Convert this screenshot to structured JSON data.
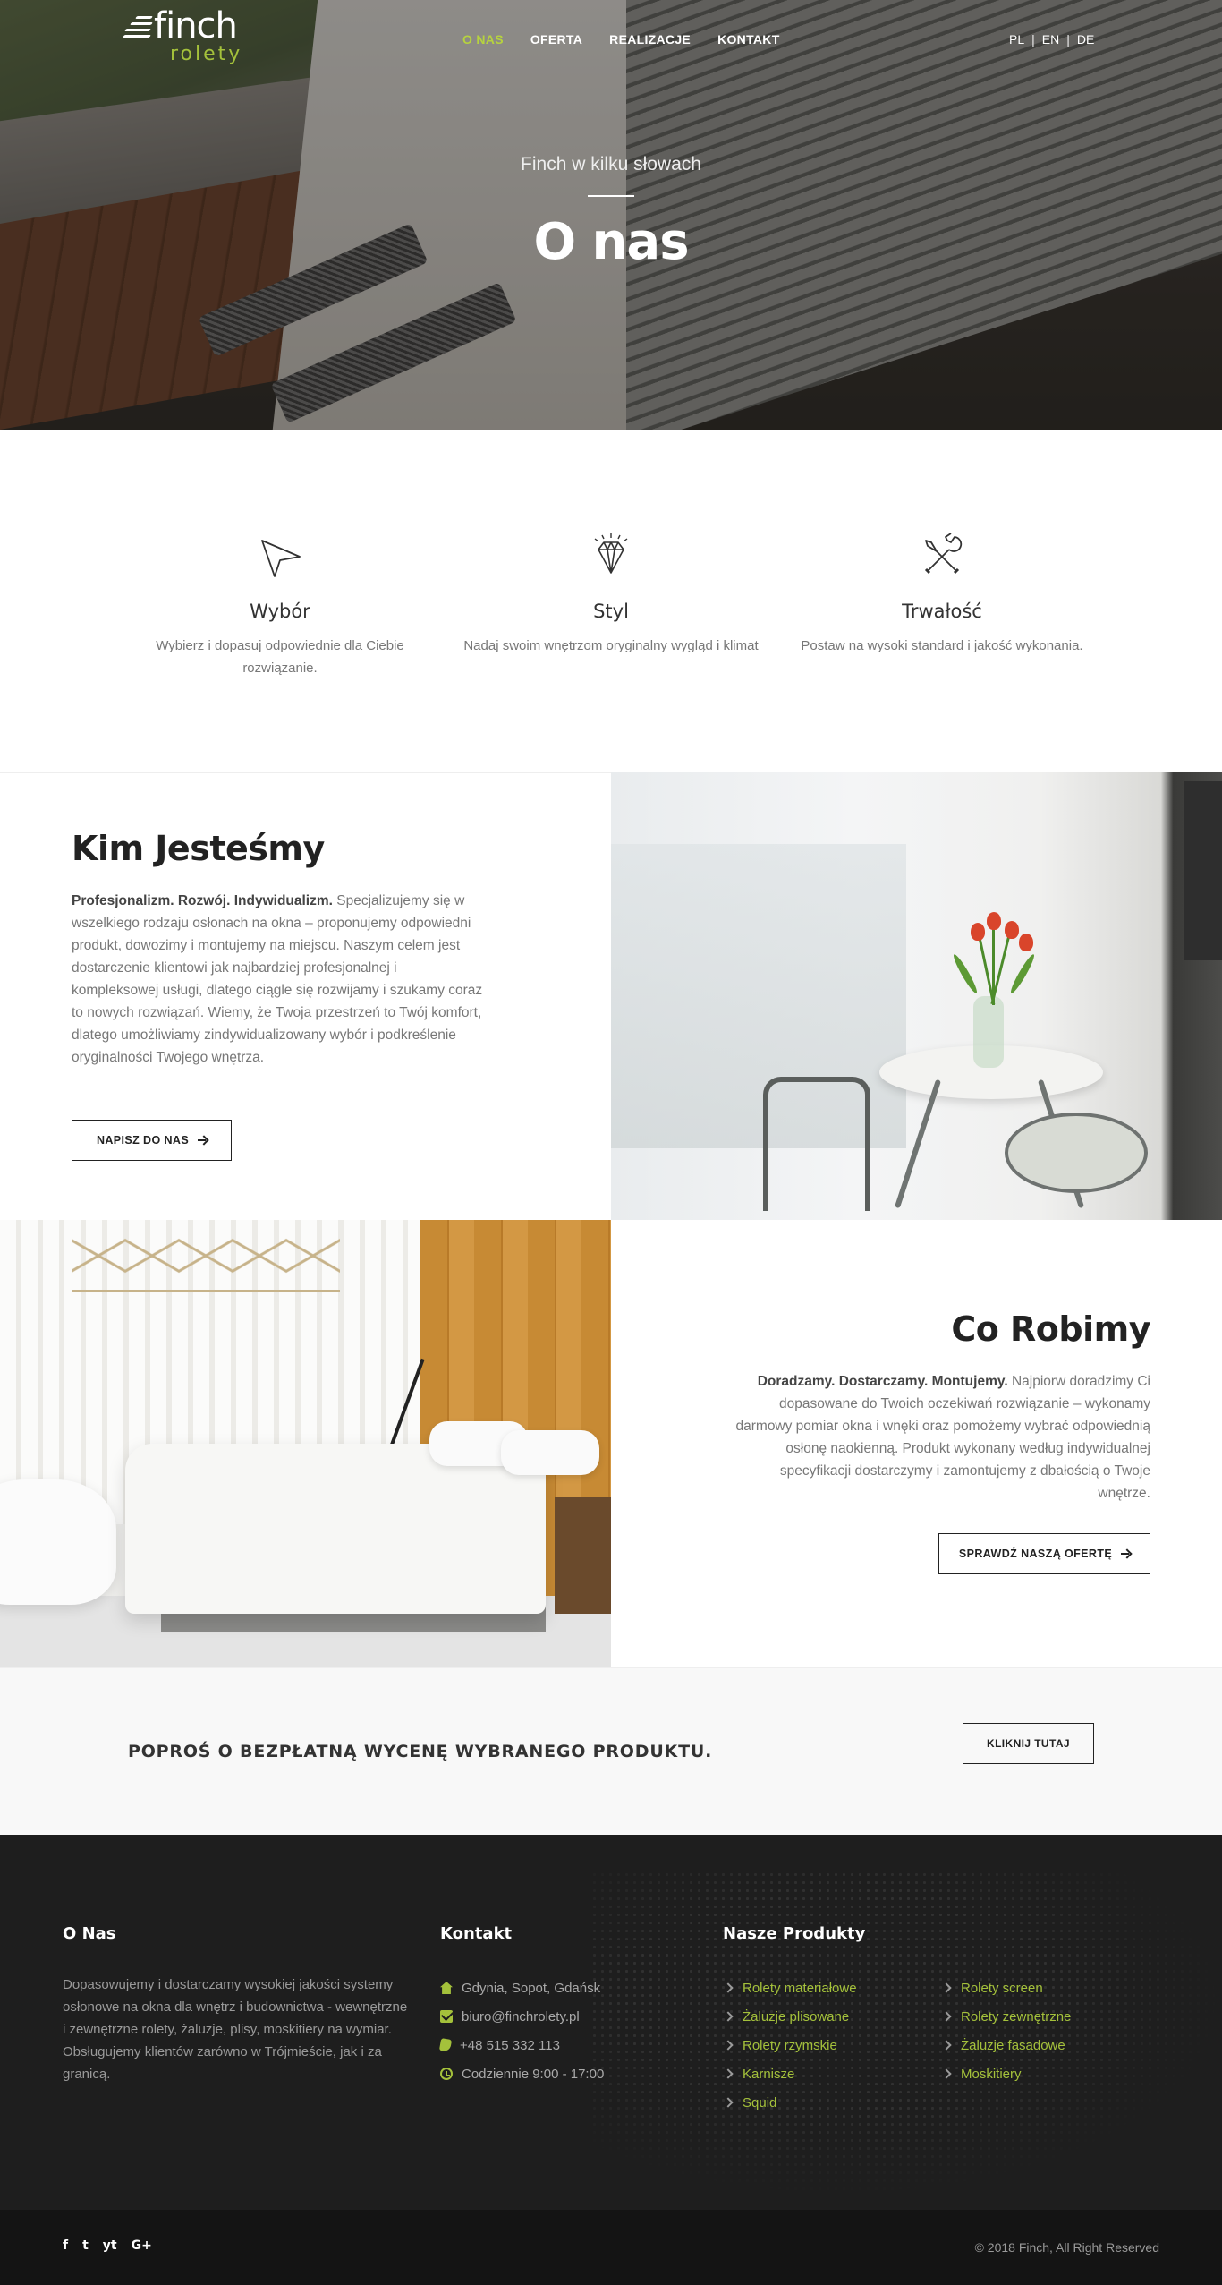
{
  "brand": {
    "name": "finch",
    "sub": "rolety",
    "accent": "#a4c13b"
  },
  "nav": {
    "items": [
      {
        "label": "O NAS",
        "active": true
      },
      {
        "label": "OFERTA",
        "active": false
      },
      {
        "label": "REALIZACJE",
        "active": false
      },
      {
        "label": "KONTAKT",
        "active": false
      }
    ],
    "langs": [
      "PL",
      "EN",
      "DE"
    ],
    "lang_sep": "|"
  },
  "hero": {
    "eyebrow": "Finch w kilku słowach",
    "title": "O nas"
  },
  "features": [
    {
      "icon": "paper-plane-icon",
      "title": "Wybór",
      "text": "Wybierz i dopasuj odpowiednie dla Ciebie rozwiązanie."
    },
    {
      "icon": "diamond-icon",
      "title": "Styl",
      "text": "Nadaj swoim wnętrzom oryginalny wygląd i klimat"
    },
    {
      "icon": "tools-icon",
      "title": "Trwałość",
      "text": "Postaw na wysoki standard i jakość wykonania."
    }
  ],
  "about": {
    "title": "Kim Jesteśmy",
    "lead": "Profesjonalizm. Rozwój. Indywidualizm.",
    "text": " Specjalizujemy się w wszelkiego rodzaju osłonach na okna – proponujemy odpowiedni produkt, dowozimy i montujemy na miejscu. Naszym celem jest dostarczenie klientowi jak najbardziej profesjonalnej i kompleksowej usługi, dlatego ciągle się rozwijamy i szukamy coraz to nowych rozwiązań. Wiemy, że Twoja przestrzeń to Twój komfort, dlatego umożliwiamy zindywidualizowany wybór i podkreślenie oryginalności Twojego wnętrza.",
    "button": "NAPISZ DO NAS"
  },
  "services": {
    "title": "Co Robimy",
    "lead": "Doradzamy. Dostarczamy. Montujemy.",
    "text": " Najpiorw doradzimy Ci dopasowane do Twoich oczekiwań rozwiązanie – wykonamy darmowy pomiar okna i wnęki oraz pomożemy wybrać odpowiednią osłonę naokienną. Produkt wykonany według indywidualnej specyfikacji dostarczymy i zamontujemy z dbałością o Twoje wnętrze.",
    "button": "SPRAWDŹ NASZĄ OFERTĘ"
  },
  "cta": {
    "text": "POPROŚ O BEZPŁATNĄ WYCENĘ WYBRANEGO PRODUKTU.",
    "button": "KLIKNIJ TUTAJ"
  },
  "footer": {
    "about": {
      "title": "O Nas",
      "text": "Dopasowujemy i dostarczamy wysokiej jakości systemy osłonowe na okna dla wnętrz i budownictwa - wewnętrzne i zewnętrzne rolety, żaluzje, plisy, moskitiery na wymiar. Obsługujemy klientów zarówno w Trójmieście, jak i za granicą."
    },
    "contact": {
      "title": "Kontakt",
      "items": [
        {
          "icon": "home-icon",
          "text": "Gdynia, Sopot, Gdańsk"
        },
        {
          "icon": "mail-icon",
          "text": "biuro@finchrolety.pl"
        },
        {
          "icon": "phone-icon",
          "text": "+48 515 332 113"
        },
        {
          "icon": "clock-icon",
          "text": "Codziennie 9:00 - 17:00"
        }
      ]
    },
    "products": {
      "title": "Nasze Produkty",
      "col1": [
        "Rolety materiałowe",
        "Żaluzje plisowane",
        "Rolety rzymskie",
        "Karnisze",
        "Squid"
      ],
      "col2": [
        "Rolety screen",
        "Rolety zewnętrzne",
        "Żaluzje fasadowe",
        "Moskitiery"
      ]
    },
    "socials": [
      {
        "icon": "facebook-icon",
        "glyph": "f"
      },
      {
        "icon": "twitter-icon",
        "glyph": "t"
      },
      {
        "icon": "youtube-icon",
        "glyph": "yt"
      },
      {
        "icon": "google-plus-icon",
        "glyph": "G+"
      }
    ],
    "copyright": "© 2018 Finch, All Right Reserved"
  }
}
